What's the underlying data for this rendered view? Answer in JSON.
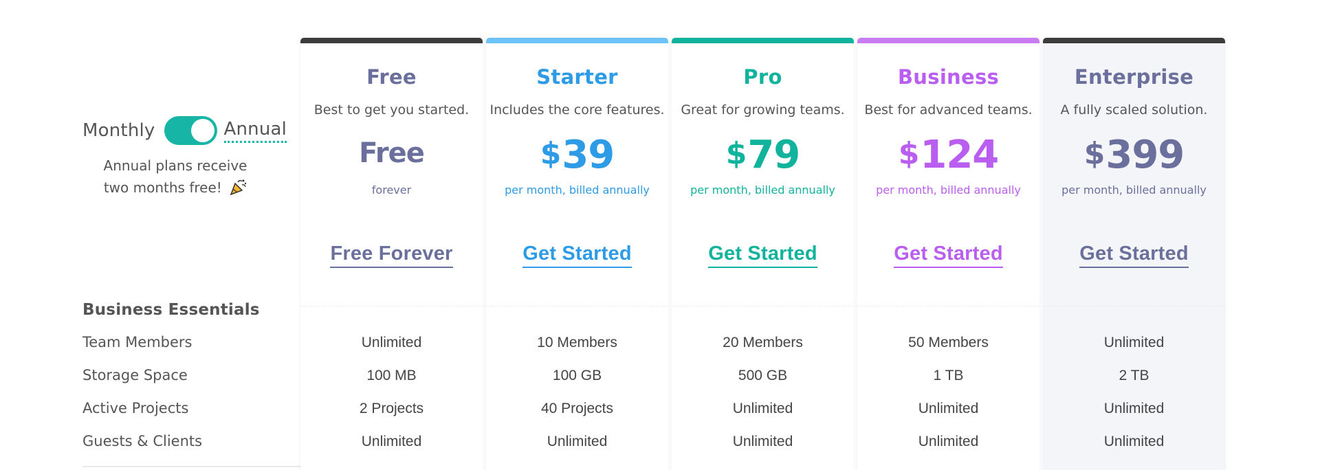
{
  "billing": {
    "monthly_label": "Monthly",
    "annual_label": "Annual",
    "toggle_state": "Annual",
    "note_line1": "Annual plans receive",
    "note_line2": "two months free!",
    "note_icon": "party-popper-icon",
    "accent_color": "#17b5a5"
  },
  "features": {
    "section_title": "Business Essentials",
    "rows": [
      "Team Members",
      "Storage Space",
      "Active Projects",
      "Guests & Clients"
    ]
  },
  "plans": [
    {
      "name": "Free",
      "tagline": "Best to get you started.",
      "currency": "",
      "price": "Free",
      "period": "forever",
      "cta": "Free Forever",
      "color": "#6b6f9c",
      "bar_color": "#3c3c3c",
      "values": [
        "Unlimited",
        "100 MB",
        "2 Projects",
        "Unlimited"
      ]
    },
    {
      "name": "Starter",
      "tagline": "Includes the core features.",
      "currency": "$",
      "price": "39",
      "period": "per month, billed annually",
      "cta": "Get Started",
      "color": "#2d9be6",
      "bar_color": "#6cc3f5",
      "values": [
        "10 Members",
        "100 GB",
        "40 Projects",
        "Unlimited"
      ]
    },
    {
      "name": "Pro",
      "tagline": "Great for growing teams.",
      "currency": "$",
      "price": "79",
      "period": "per month, billed annually",
      "cta": "Get Started",
      "color": "#12b39d",
      "bar_color": "#12b39d",
      "values": [
        "20 Members",
        "500 GB",
        "Unlimited",
        "Unlimited"
      ]
    },
    {
      "name": "Business",
      "tagline": "Best for advanced teams.",
      "currency": "$",
      "price": "124",
      "period": "per month, billed annually",
      "cta": "Get Started",
      "color": "#b95ef0",
      "bar_color": "#c97bf2",
      "values": [
        "50 Members",
        "1 TB",
        "Unlimited",
        "Unlimited"
      ]
    },
    {
      "name": "Enterprise",
      "tagline": "A fully scaled solution.",
      "currency": "$",
      "price": "399",
      "period": "per month, billed annually",
      "cta": "Get Started",
      "color": "#6b6f9c",
      "bar_color": "#3c3c3c",
      "values": [
        "Unlimited",
        "2 TB",
        "Unlimited",
        "Unlimited"
      ]
    }
  ]
}
